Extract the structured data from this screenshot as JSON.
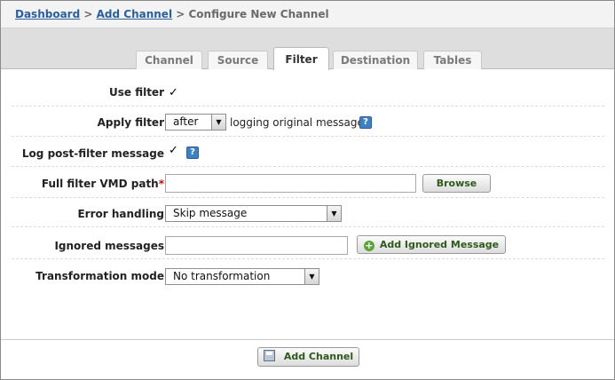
{
  "breadcrumb": {
    "items": [
      "Dashboard",
      "Add Channel",
      "Configure New Channel"
    ],
    "separator": ">"
  },
  "tabs": [
    {
      "label": "Channel",
      "active": false
    },
    {
      "label": "Source",
      "active": false
    },
    {
      "label": "Filter",
      "active": true
    },
    {
      "label": "Destination",
      "active": false
    },
    {
      "label": "Tables",
      "active": false
    }
  ],
  "form": {
    "use_filter": {
      "label": "Use filter",
      "checked": true
    },
    "apply_filter": {
      "label": "Apply filter",
      "value": "after",
      "suffix": "logging original message"
    },
    "log_post_filter": {
      "label": "Log post-filter message",
      "checked": true
    },
    "vmd_path": {
      "label": "Full filter VMD path",
      "required_mark": "*",
      "value": "",
      "browse_label": "Browse"
    },
    "error_handling": {
      "label": "Error handling",
      "value": "Skip message"
    },
    "ignored_messages": {
      "label": "Ignored messages",
      "value": "",
      "add_label": "Add Ignored Message"
    },
    "transformation_mode": {
      "label": "Transformation mode",
      "value": "No transformation"
    }
  },
  "footer": {
    "add_channel_label": "Add Channel"
  },
  "glyphs": {
    "check": "✓",
    "help": "?",
    "dropdown": "▼",
    "plus": "+"
  },
  "colors": {
    "link": "#2a5f9e",
    "button_text": "#2e5a1a",
    "help_icon": "#3d80c4",
    "required": "#dd0000"
  }
}
